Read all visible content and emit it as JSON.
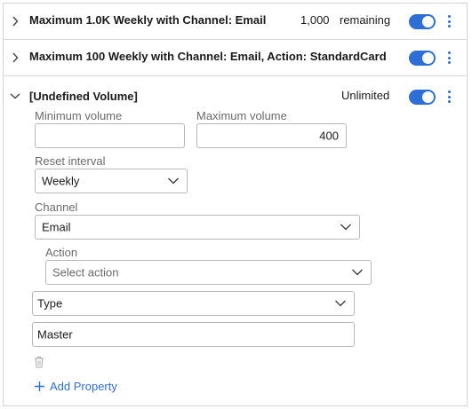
{
  "rules": [
    {
      "title": "Maximum 1.0K Weekly with Channel: Email",
      "count": "1,000",
      "remaining_label": "remaining",
      "enabled": true
    },
    {
      "title": "Maximum 100 Weekly with Channel: Email, Action: StandardCard",
      "enabled": true
    },
    {
      "title": "[Undefined Volume]",
      "status": "Unlimited",
      "enabled": true,
      "form": {
        "min_volume_label": "Minimum volume",
        "min_volume_value": "",
        "max_volume_label": "Maximum volume",
        "max_volume_value": "400",
        "reset_interval_label": "Reset interval",
        "reset_interval_value": "Weekly",
        "channel_label": "Channel",
        "channel_value": "Email",
        "action_label": "Action",
        "action_placeholder": "Select action",
        "type_value": "Type",
        "master_value": "Master",
        "add_property_label": "Add Property"
      }
    }
  ],
  "colors": {
    "accent": "#2e6fd6",
    "border": "#b8b8b8",
    "label": "#6b6b6b"
  },
  "icons": [
    "chevron-right-icon",
    "chevron-down-icon",
    "kebab-menu-icon",
    "trash-icon",
    "plus-icon"
  ]
}
